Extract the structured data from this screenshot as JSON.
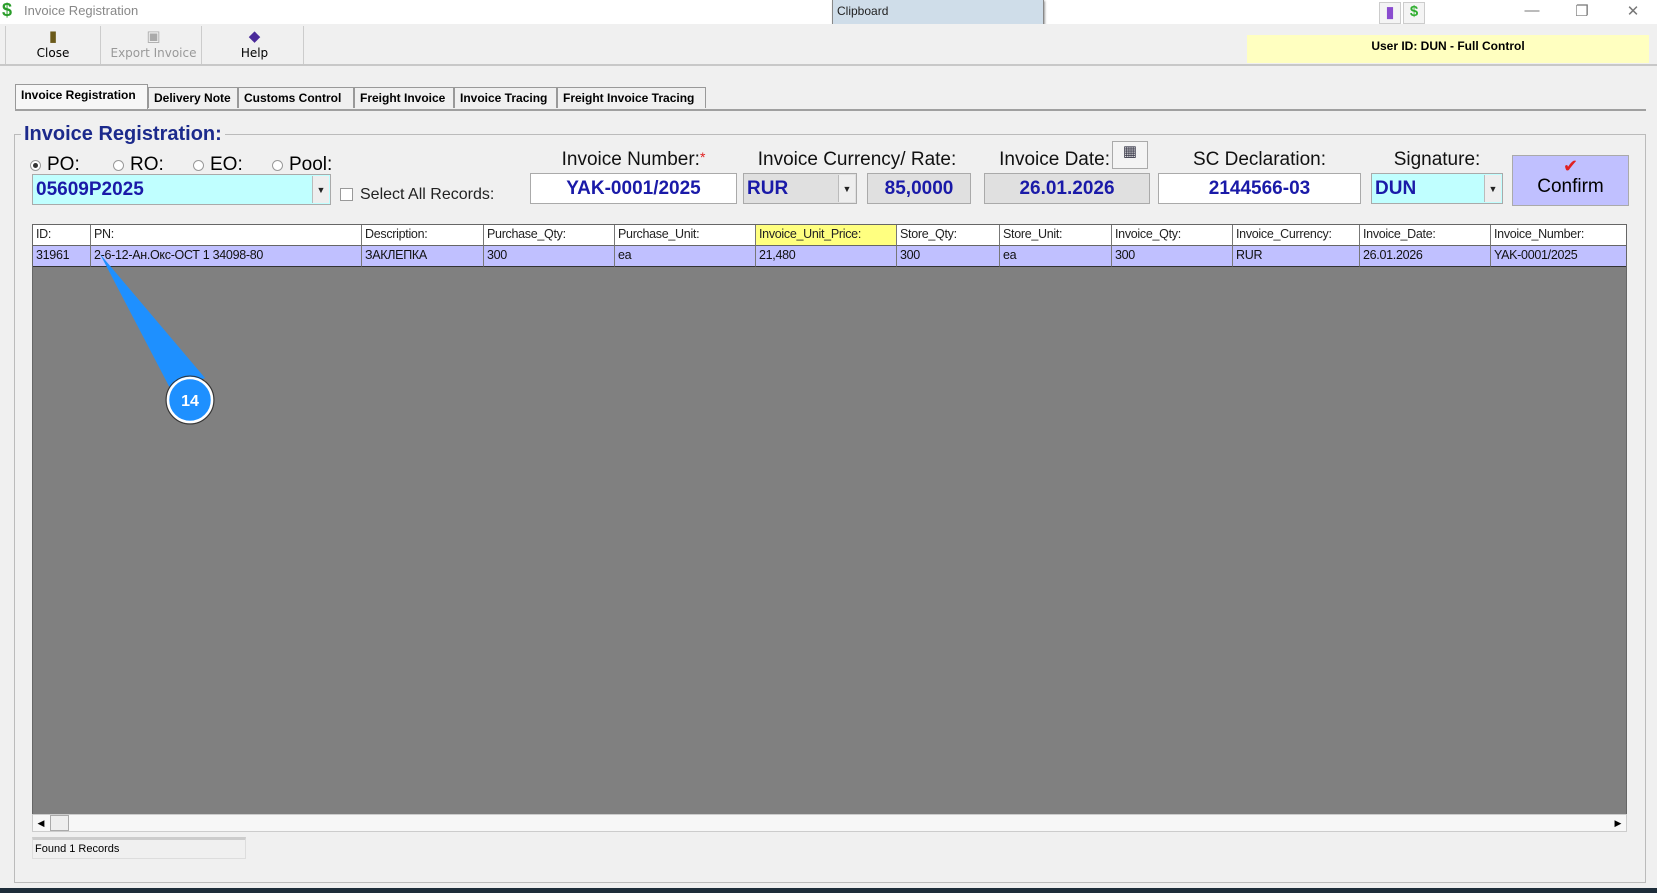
{
  "window": {
    "title": "Invoice Registration",
    "controls": [
      "—",
      "❐",
      "✕"
    ]
  },
  "clipboard": {
    "label": "Clipboard"
  },
  "toolbar": {
    "close": "Close",
    "export": "Export Invoice",
    "help": "Help"
  },
  "user": {
    "label": "User ID: DUN - Full Control"
  },
  "tabs": [
    "Invoice Registration",
    "Delivery Note",
    "Customs Control",
    "Freight Invoice",
    "Invoice Tracing",
    "Freight Invoice Tracing"
  ],
  "form": {
    "group_title": "Invoice Registration:",
    "radios": [
      "PO:",
      "RO:",
      "EO:",
      "Pool:"
    ],
    "selected_radio": "PO:",
    "order_value": "05609P2025",
    "select_all_label": "Select All Records:",
    "invoice_number_label": "Invoice Number:",
    "required_mark": "*",
    "invoice_number": "YAK-0001/2025",
    "currency_label": "Invoice Currency/ Rate:",
    "currency": "RUR",
    "rate": "85,0000",
    "date_label": "Invoice Date:",
    "date": "26.01.2026",
    "sc_label": "SC Declaration:",
    "sc_value": "2144566-03",
    "signature_label": "Signature:",
    "signature": "DUN",
    "confirm": "Confirm"
  },
  "grid": {
    "columns": [
      "ID:",
      "PN:",
      "Description:",
      "Purchase_Qty:",
      "Purchase_Unit:",
      "Invoice_Unit_Price:",
      "Store_Qty:",
      "Store_Unit:",
      "Invoice_Qty:",
      "Invoice_Currency:",
      "Invoice_Date:",
      "Invoice_Number:"
    ],
    "rows": [
      [
        "31961",
        "2-6-12-Ан.Окс-ОСТ 1 34098-80",
        "ЗАКЛЕПКА",
        "300",
        "ea",
        "21,480",
        "300",
        "ea",
        "300",
        "RUR",
        "26.01.2026",
        "YAK-0001/2025"
      ]
    ]
  },
  "status": "Found 1 Records",
  "callout": {
    "number": "14"
  },
  "colors": {
    "accent": "#1c2a8c",
    "row": "#c0c0ff",
    "highlight": "#ffff80",
    "callout": "#1e90ff"
  }
}
